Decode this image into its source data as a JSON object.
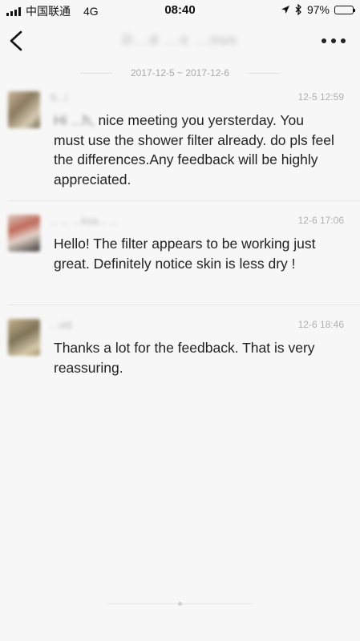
{
  "status_bar": {
    "carrier": "中国联通",
    "network": "4G",
    "time": "08:40",
    "battery": "97%",
    "battery_level": 0.97
  },
  "nav": {
    "title": "D...d ...s ...nus",
    "back_icon": "chevron-left-icon",
    "more_icon": "more-dots-icon"
  },
  "history": {
    "date_range": "2017-12-5 ~ 2017-12-6"
  },
  "messages": [
    {
      "sender": "S...i",
      "time": "12-5 12:59",
      "text_prefix": "Hi ...h,",
      "text": " nice meeting you yersterday. You must use the shower filter already. do pls feel the differences.Any feedback will be highly appreciated."
    },
    {
      "sender": "... ... ...ksa... ...",
      "time": "12-6 17:06",
      "text": "Hello! The filter appears to be working just great. Definitely notice skin is less dry !"
    },
    {
      "sender": "...vid",
      "time": "12-6 18:46",
      "text": "Thanks a lot for the feedback. That is very reassuring."
    }
  ]
}
